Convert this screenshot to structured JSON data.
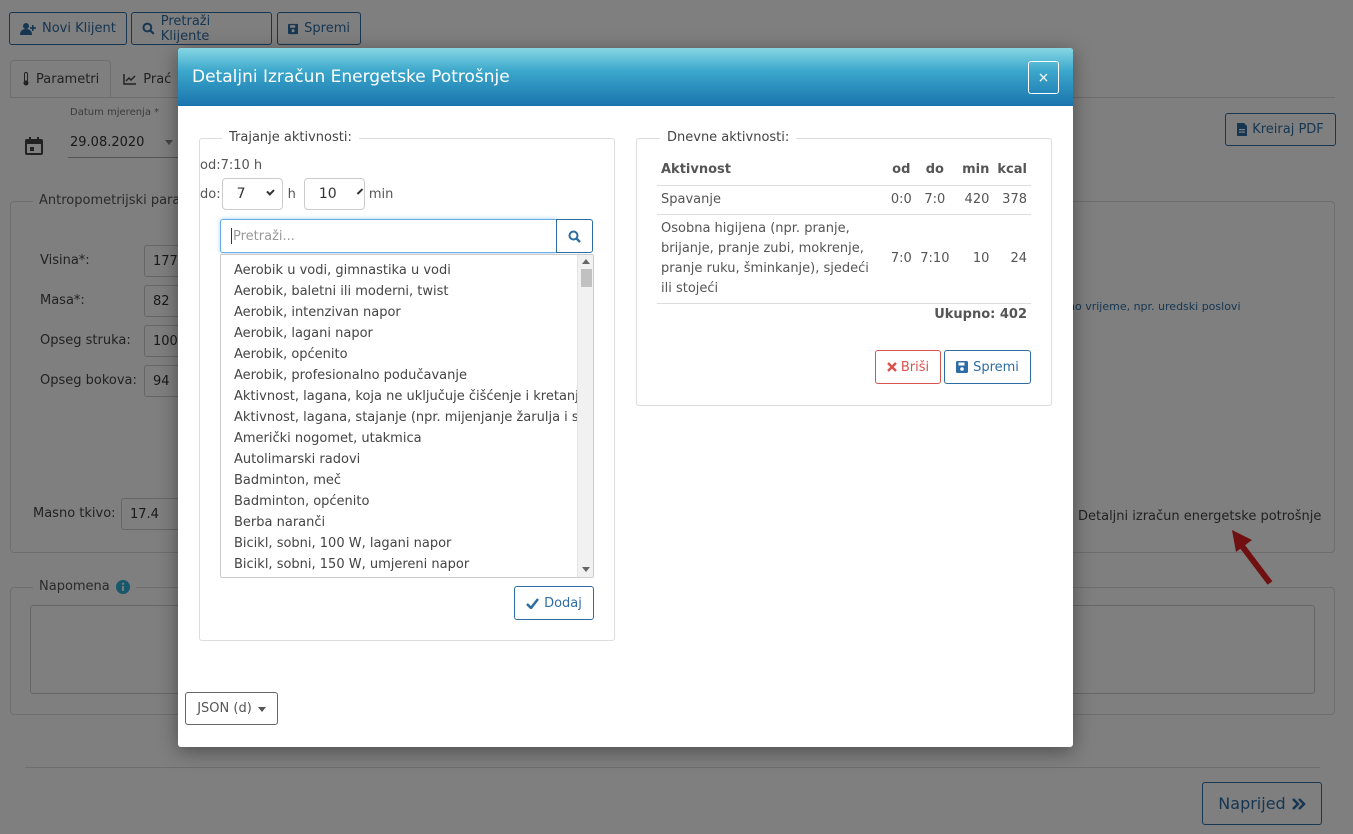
{
  "toolbar": {
    "new_client": "Novi Klijent",
    "search_clients": "Pretraži Klijente",
    "save": "Spremi"
  },
  "tabs": [
    {
      "label": "Parametri"
    },
    {
      "label": "Prać"
    }
  ],
  "date": {
    "label": "Datum mjerenja *",
    "value": "29.08.2020"
  },
  "background": {
    "anthropometric_legend": "Antropometrijski para",
    "height_label": "Visina*:",
    "height_value": "177",
    "mass_label": "Masa*:",
    "mass_value": "82",
    "waist_label": "Opseg struka:",
    "waist_value": "100",
    "hip_label": "Opseg bokova:",
    "hip_value": "94",
    "fat_label": "Masno tkivo:",
    "fat_value": "17.4",
    "pdf_label": "Kreiraj PDF",
    "side_text": "no vrijeme, npr. uredski poslovi",
    "detail_link": "Detaljni izračun energetske potrošnje",
    "note_legend": "Napomena",
    "next_label": "Naprijed"
  },
  "modal": {
    "title": "Detaljni Izračun Energetske Potrošnje",
    "close": "×",
    "duration": {
      "legend": "Trajanje aktivnosti:",
      "od_label": "od:",
      "od_value": "7:10 h",
      "do_label": "do:",
      "hour_value": "7",
      "hour_unit": "h",
      "min_value": "10",
      "min_unit": "min",
      "search_placeholder": "Pretraži...",
      "activities": [
        "Aerobik u vodi, gimnastika u vodi",
        "Aerobik, baletni ili moderni, twist",
        "Aerobik, intenzivan napor",
        "Aerobik, lagani napor",
        "Aerobik, općenito",
        "Aerobik, profesionalno podučavanje",
        "Aktivnost, lagana, koja ne uključuje čišćenje i kretanje",
        "Aktivnost, lagana, stajanje (npr. mijenjanje žarulja i sl.)",
        "Američki nogomet, utakmica",
        "Autolimarski radovi",
        "Badminton, meč",
        "Badminton, općenito",
        "Berba naranči",
        "Bicikl, sobni, 100 W, lagani napor",
        "Bicikl, sobni, 150 W, umjereni napor"
      ],
      "add_label": "Dodaj"
    },
    "daily": {
      "legend": "Dnevne aktivnosti:",
      "headers": {
        "activity": "Aktivnost",
        "od": "od",
        "do": "do",
        "min": "min",
        "kcal": "kcal"
      },
      "rows": [
        {
          "activity": "Spavanje",
          "od": "0:0",
          "do": "7:0",
          "min": "420",
          "kcal": "378"
        },
        {
          "activity": "Osobna higijena (npr. pranje, brijanje, pranje zubi, mokrenje, pranje ruku, šminkanje), sjedeći ili stojeći",
          "od": "7:0",
          "do": "7:10",
          "min": "10",
          "kcal": "24"
        }
      ],
      "total": "Ukupno: 402",
      "delete_label": "Briši",
      "save_label": "Spremi"
    },
    "json_label": "JSON (d)"
  },
  "colors": {
    "primary": "#2e6da4",
    "danger": "#d9534f",
    "header_top": "#86d6e3",
    "header_bottom": "#1a74ad",
    "arrow": "#e02020"
  }
}
